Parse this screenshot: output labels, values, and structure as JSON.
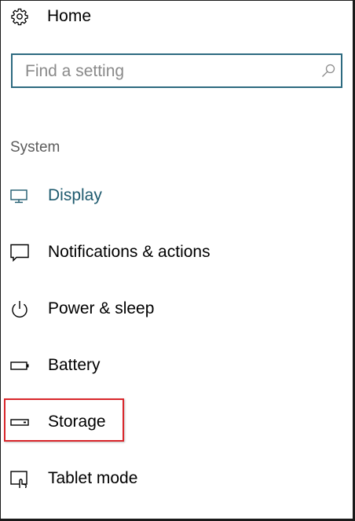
{
  "home": {
    "label": "Home",
    "icon": "gear-icon"
  },
  "search": {
    "placeholder": "Find a setting",
    "icon": "search-icon"
  },
  "section": {
    "label": "System"
  },
  "items": [
    {
      "label": "Display",
      "icon": "display-icon",
      "active": true
    },
    {
      "label": "Notifications & actions",
      "icon": "notifications-icon"
    },
    {
      "label": "Power & sleep",
      "icon": "power-icon"
    },
    {
      "label": "Battery",
      "icon": "battery-icon"
    },
    {
      "label": "Storage",
      "icon": "storage-icon",
      "highlighted": true
    },
    {
      "label": "Tablet mode",
      "icon": "tablet-mode-icon"
    }
  ],
  "colors": {
    "accent": "#1e5a6e",
    "search_border": "#2d6a80",
    "highlight_border": "#d9262b"
  }
}
